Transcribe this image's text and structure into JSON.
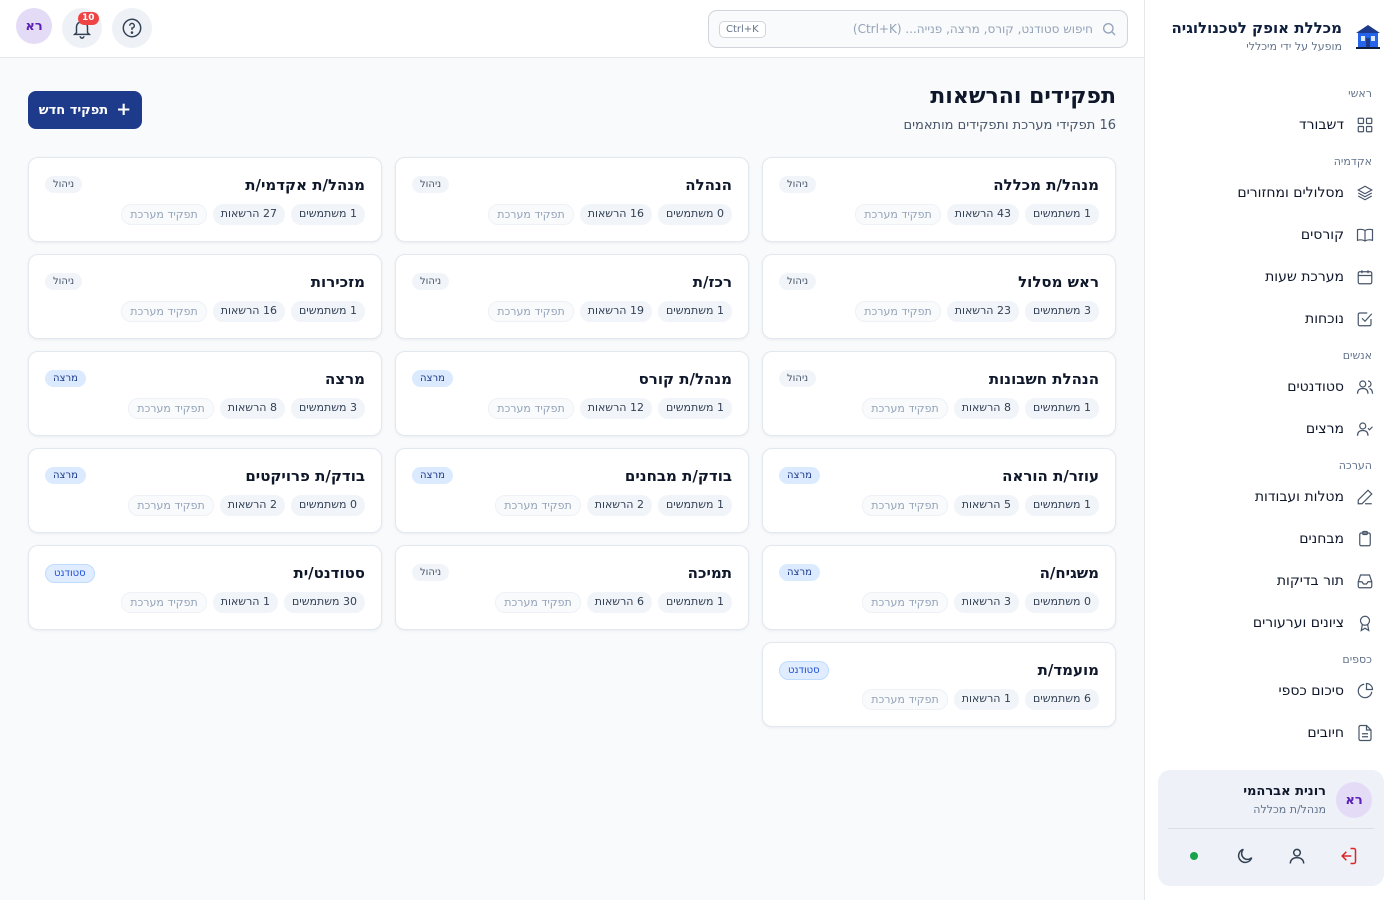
{
  "brand": {
    "title": "מכללת אופק לטכנולוגיה",
    "subtitle": "מופעל על ידי מיכללי"
  },
  "search": {
    "placeholder": "חיפוש סטודנט, קורס, מרצה, פנייה... (Ctrl+K)",
    "shortcut": "Ctrl+K"
  },
  "topbar": {
    "notif_count": "10",
    "avatar": "רא"
  },
  "nav": {
    "sec_main": "ראשי",
    "dashboard": "דשבורד",
    "sec_academy": "אקדמיה",
    "tracks": "מסלולים ומחזורים",
    "courses": "קורסים",
    "schedule": "מערכת שעות",
    "attendance": "נוכחות",
    "sec_people": "אנשים",
    "students": "סטודנטים",
    "lecturers": "מרצים",
    "sec_eval": "הערכה",
    "assignments": "מטלות ועבודות",
    "exams": "מבחנים",
    "grading_queue": "תור בדיקות",
    "grades": "ציונים וערעורים",
    "sec_finance": "כספים",
    "fin_summary": "סיכום כספי",
    "invoices": "חיובים"
  },
  "user": {
    "initials": "רא",
    "name": "רונית אברהמי",
    "role": "מנהל/ת מכללה"
  },
  "page": {
    "title": "תפקידים והרשאות",
    "subtitle": "16 תפקידי מערכת ותפקידים מותאמים",
    "new_button": "תפקיד חדש"
  },
  "roles": [
    {
      "name": "מנהל/ת מכללה",
      "users": "1 משתמשים",
      "perms": "43 הרשאות",
      "sys": "תפקיד מערכת",
      "tag": "ניהול",
      "kind": "mgmt"
    },
    {
      "name": "הנהלה",
      "users": "0 משתמשים",
      "perms": "16 הרשאות",
      "sys": "תפקיד מערכת",
      "tag": "ניהול",
      "kind": "mgmt"
    },
    {
      "name": "מנהל/ת אקדמי/ת",
      "users": "1 משתמשים",
      "perms": "27 הרשאות",
      "sys": "תפקיד מערכת",
      "tag": "ניהול",
      "kind": "mgmt"
    },
    {
      "name": "ראש מסלול",
      "users": "3 משתמשים",
      "perms": "23 הרשאות",
      "sys": "תפקיד מערכת",
      "tag": "ניהול",
      "kind": "mgmt"
    },
    {
      "name": "רכז/ת",
      "users": "1 משתמשים",
      "perms": "19 הרשאות",
      "sys": "תפקיד מערכת",
      "tag": "ניהול",
      "kind": "mgmt"
    },
    {
      "name": "מזכירות",
      "users": "1 משתמשים",
      "perms": "16 הרשאות",
      "sys": "תפקיד מערכת",
      "tag": "ניהול",
      "kind": "mgmt"
    },
    {
      "name": "הנהלת חשבונות",
      "users": "1 משתמשים",
      "perms": "8 הרשאות",
      "sys": "תפקיד מערכת",
      "tag": "ניהול",
      "kind": "mgmt"
    },
    {
      "name": "מנהל/ת קורס",
      "users": "1 משתמשים",
      "perms": "12 הרשאות",
      "sys": "תפקיד מערכת",
      "tag": "מרצה",
      "kind": "lect"
    },
    {
      "name": "מרצה",
      "users": "3 משתמשים",
      "perms": "8 הרשאות",
      "sys": "תפקיד מערכת",
      "tag": "מרצה",
      "kind": "lect"
    },
    {
      "name": "עוזר/ת הוראה",
      "users": "1 משתמשים",
      "perms": "5 הרשאות",
      "sys": "תפקיד מערכת",
      "tag": "מרצה",
      "kind": "lect"
    },
    {
      "name": "בודק/ת מבחנים",
      "users": "1 משתמשים",
      "perms": "2 הרשאות",
      "sys": "תפקיד מערכת",
      "tag": "מרצה",
      "kind": "lect"
    },
    {
      "name": "בודק/ת פרויקטים",
      "users": "0 משתמשים",
      "perms": "2 הרשאות",
      "sys": "תפקיד מערכת",
      "tag": "מרצה",
      "kind": "lect"
    },
    {
      "name": "משגיח/ה",
      "users": "0 משתמשים",
      "perms": "3 הרשאות",
      "sys": "תפקיד מערכת",
      "tag": "מרצה",
      "kind": "lect"
    },
    {
      "name": "תמיכה",
      "users": "1 משתמשים",
      "perms": "6 הרשאות",
      "sys": "תפקיד מערכת",
      "tag": "ניהול",
      "kind": "mgmt"
    },
    {
      "name": "סטודנט/ית",
      "users": "30 משתמשים",
      "perms": "1 הרשאות",
      "sys": "תפקיד מערכת",
      "tag": "סטודנט",
      "kind": "stud"
    },
    {
      "name": "מועמד/ת",
      "users": "6 משתמשים",
      "perms": "1 הרשאות",
      "sys": "תפקיד מערכת",
      "tag": "סטודנט",
      "kind": "stud"
    }
  ]
}
